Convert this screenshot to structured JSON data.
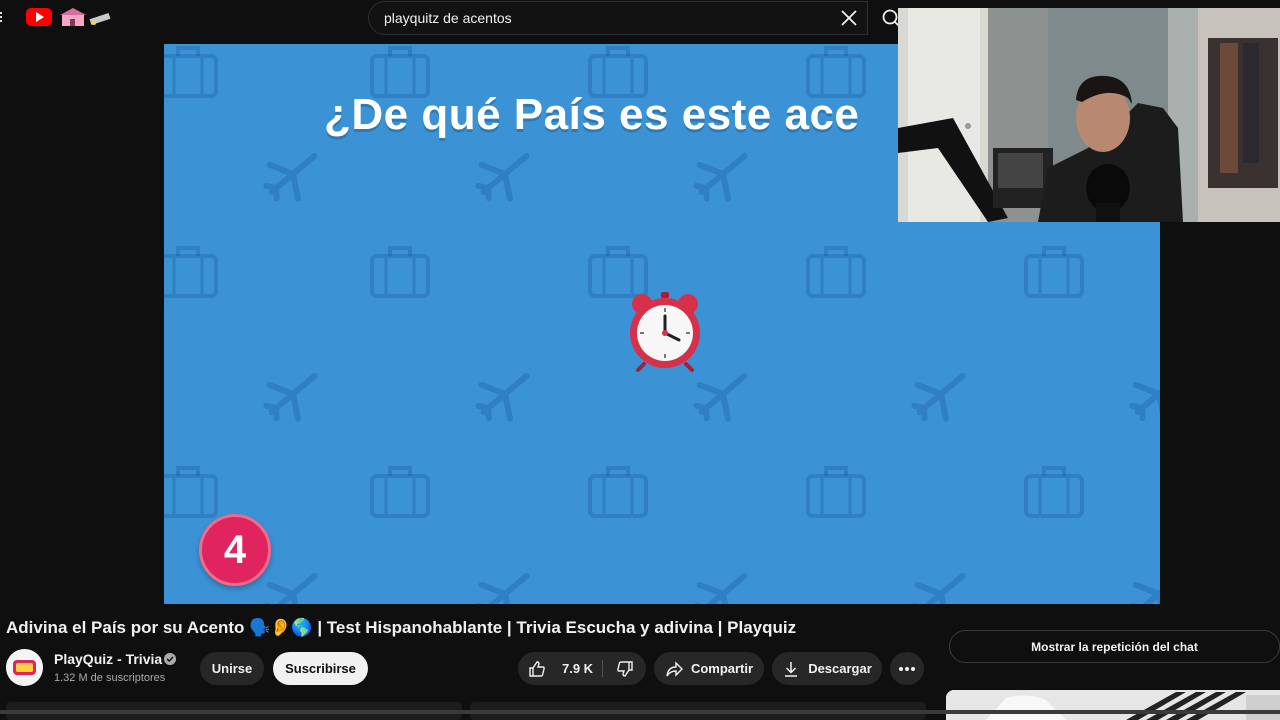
{
  "search": {
    "query": "playquitz de acentos"
  },
  "video": {
    "question": "¿De qué País es este ace",
    "number": "4"
  },
  "title": "Adivina el País por su Acento 🗣️👂🌎 | Test Hispanohablante | Trivia Escucha y adivina | Playquiz",
  "channel": {
    "name": "PlayQuiz - Trivia",
    "subscribers": "1.32 M de suscriptores"
  },
  "actions": {
    "join": "Unirse",
    "subscribe": "Suscribirse",
    "likes": "7.9 K",
    "share": "Compartir",
    "download": "Descargar"
  },
  "chat": {
    "replay_label": "Mostrar la repetición del chat"
  },
  "colors": {
    "video_bg": "#3b93d6",
    "badge": "#e0245e",
    "youtube_red": "#ff0000"
  }
}
